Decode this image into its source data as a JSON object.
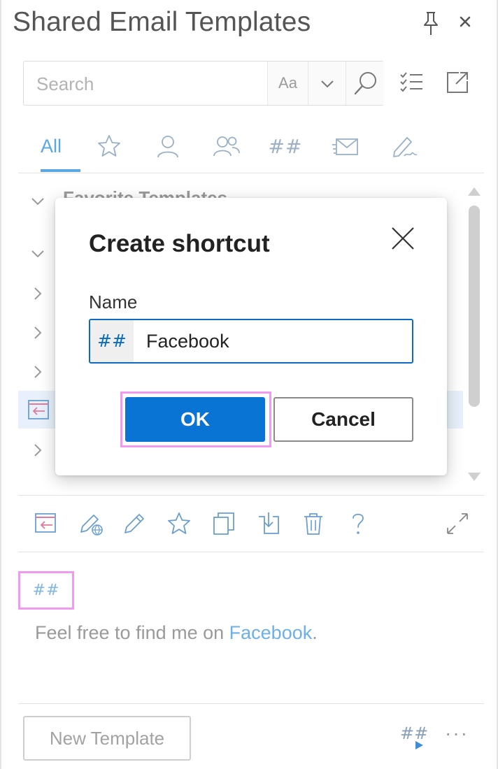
{
  "window": {
    "title": "Shared Email Templates"
  },
  "search": {
    "placeholder": "Search",
    "match_case_label": "Aa"
  },
  "tabs": {
    "all_label": "All",
    "hash_label": "##"
  },
  "list": {
    "partial_row_text": "Favorite Templates"
  },
  "dialog": {
    "title": "Create shortcut",
    "name_label": "Name",
    "name_prefix": "##",
    "name_value": "Facebook",
    "ok_label": "OK",
    "cancel_label": "Cancel"
  },
  "preview": {
    "shortcut_tag": "##",
    "text_before": "Feel free to find me on ",
    "link_text": "Facebook",
    "text_after": "."
  },
  "footer": {
    "new_template_label": "New Template",
    "more_label": "···",
    "hash_label": "##"
  },
  "colors": {
    "accent": "#0a74d4",
    "tab_active": "#5aa8df",
    "highlight_outline": "#f29af2",
    "icon_blue": "#6a9fd0",
    "icon_gray": "#9a9a9a"
  }
}
